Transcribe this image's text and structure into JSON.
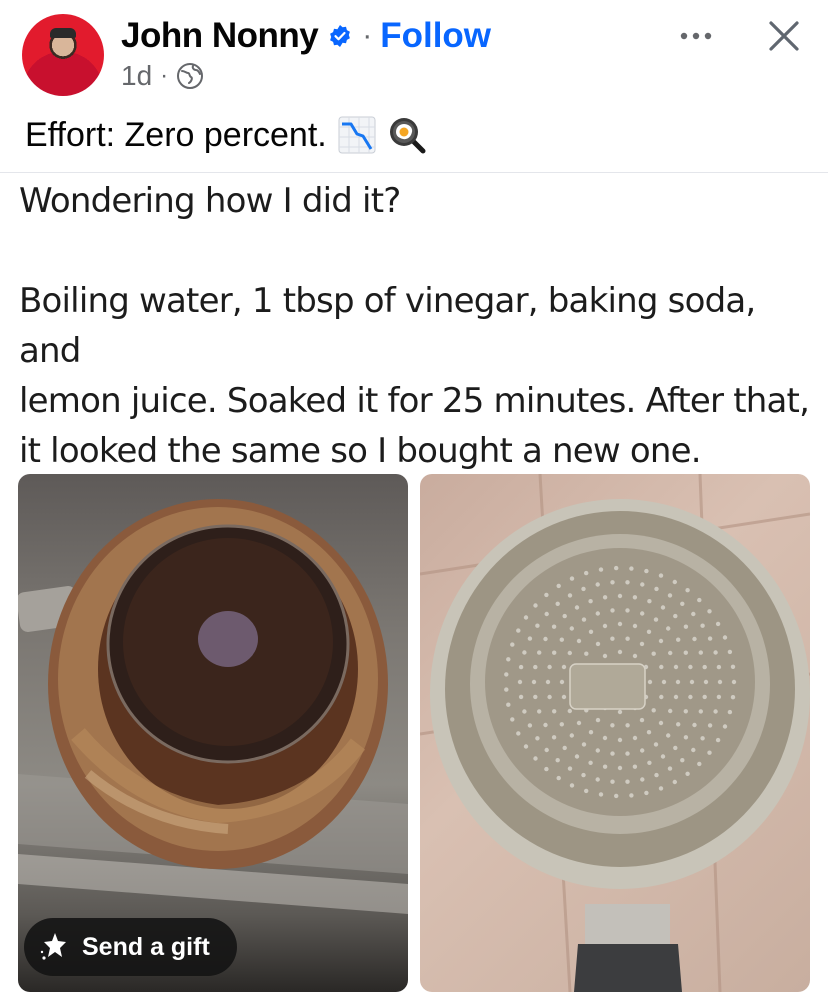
{
  "post": {
    "author": "John Nonny",
    "follow_label": "Follow",
    "separator": "·",
    "time": "1d",
    "caption": "Effort: Zero percent.",
    "caption_emojis": [
      "chart-decreasing-icon",
      "frying-pan-egg-icon"
    ],
    "body": {
      "line1": "Wondering how I did it?",
      "para2": [
        "Boiling water, 1 tbsp of vinegar, baking soda, and",
        "lemon juice. Soaked it for 25 minutes. After that,",
        "it looked the same so I bought a new one."
      ]
    },
    "images": [
      {
        "name": "burnt-pan-photo",
        "description": "dirty burnt pan bottom in sink"
      },
      {
        "name": "new-pan-photo",
        "description": "clean new pan bottom"
      }
    ]
  },
  "gift_button": {
    "label": "Send a gift"
  },
  "icons": {
    "verified": "verified-badge-icon",
    "audience": "globe-icon",
    "more": "more-options-icon",
    "close": "close-icon"
  },
  "colors": {
    "link": "#0866ff",
    "muted": "#65676b",
    "badge": "#0866ff"
  }
}
